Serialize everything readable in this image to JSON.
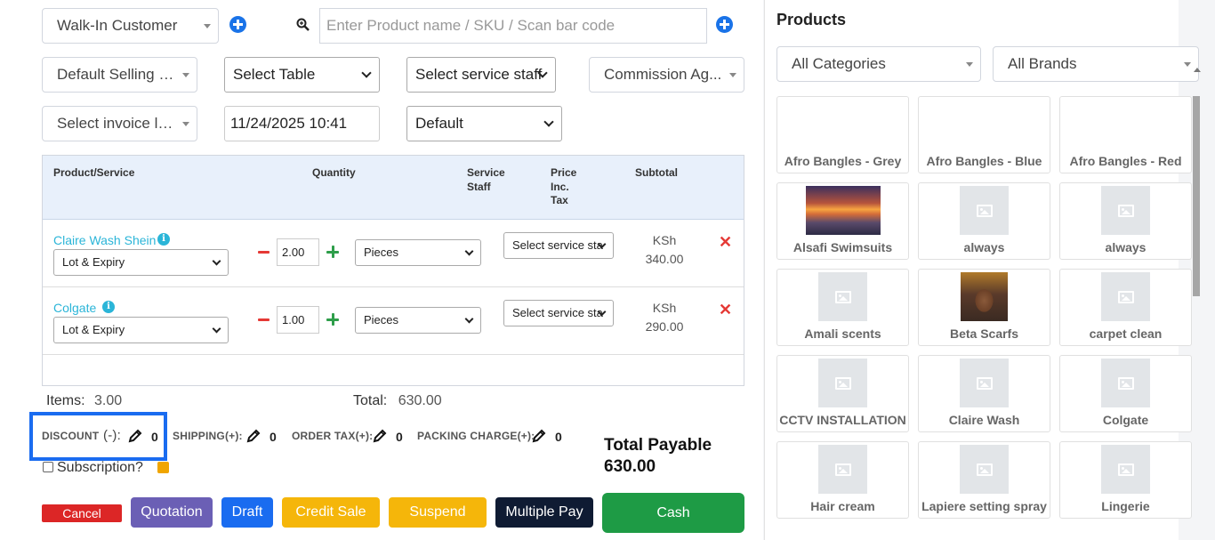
{
  "header": {
    "customer": "Walk-In Customer",
    "search_placeholder": "Enter Product name / SKU / Scan bar code",
    "selling_price_group": "Default Selling P...",
    "table": "Select Table",
    "service_staff": "Select service staff",
    "commission_agent": "Commission Ag...",
    "invoice_layout": "Select invoice la...",
    "transaction_date": "11/24/2025 10:41",
    "invoice_scheme": "Default"
  },
  "cart": {
    "columns": [
      "Product/Service",
      "Quantity",
      "Service Staff",
      "Price Inc. Tax",
      "Subtotal"
    ],
    "col_service_staff_1": "Service",
    "col_service_staff_2": "Staff",
    "col_price_1": "Price",
    "col_price_2": "Inc.",
    "col_price_3": "Tax",
    "rows": [
      {
        "name": "Claire Wash Shein",
        "lot": "Lot & Expiry",
        "quantity": "2.00",
        "unit": "Pieces",
        "service_staff": "Select service sta",
        "currency": "KSh",
        "subtotal": "340.00"
      },
      {
        "name": "Colgate",
        "lot": "Lot & Expiry",
        "quantity": "1.00",
        "unit": "Pieces",
        "service_staff": "Select service sta",
        "currency": "KSh",
        "subtotal": "290.00"
      }
    ]
  },
  "summary": {
    "items_label": "Items:",
    "items_value": "3.00",
    "total_label": "Total:",
    "total_value": "630.00",
    "discount_label": "DISCOUNT",
    "discount_sign": "(-):",
    "discount_value": "0",
    "shipping_label": "SHIPPING(+):",
    "shipping_value": "0",
    "order_tax_label": "ORDER TAX(+):",
    "order_tax_value": "0",
    "packing_label": "PACKING CHARGE(+):",
    "packing_value": "0",
    "subscription_label": "Subscription?",
    "payable_label": "Total Payable",
    "payable_value": "630.00"
  },
  "actions": {
    "cancel": "Cancel",
    "quotation": "Quotation",
    "draft": "Draft",
    "credit_sale": "Credit Sale",
    "suspend": "Suspend",
    "multiple_pay": "Multiple Pay",
    "cash": "Cash"
  },
  "products_panel": {
    "title": "Products",
    "category_filter": "All Categories",
    "brand_filter": "All Brands",
    "products": [
      "Afro Bangles - Grey",
      "Afro Bangles - Blue",
      "Afro Bangles - Red",
      "Alsafi Swimsuits",
      "always",
      "always",
      "Amali scents",
      "Beta Scarfs",
      "carpet clean",
      "CCTV INSTALLATION",
      "Claire Wash",
      "Colgate",
      "Hair cream",
      "Lapiere setting spray",
      "Lingerie"
    ]
  },
  "colors": {
    "primary": "#1a6cf0",
    "success": "#1e9b45",
    "danger": "#dc2626",
    "warning": "#f5b60a",
    "link": "#2bb5d8"
  }
}
